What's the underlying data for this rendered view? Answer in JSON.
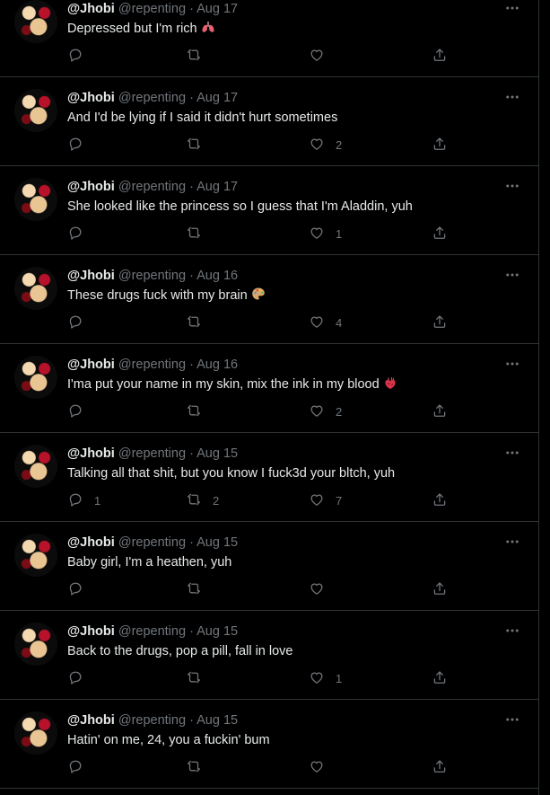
{
  "tweets": [
    {
      "name": "@Jhobi",
      "handle": "@repenting",
      "sep": "·",
      "date": "Aug 17",
      "text": "Depressed but I'm rich",
      "emoji": "lungs-emoji",
      "replies": "",
      "retweets": "",
      "likes": ""
    },
    {
      "name": "@Jhobi",
      "handle": "@repenting",
      "sep": "·",
      "date": "Aug 17",
      "text": "And I'd be lying if I said it didn't hurt sometimes",
      "emoji": "",
      "replies": "",
      "retweets": "",
      "likes": "2"
    },
    {
      "name": "@Jhobi",
      "handle": "@repenting",
      "sep": "·",
      "date": "Aug 17",
      "text": "She looked like the princess so I guess that I'm Aladdin, yuh",
      "emoji": "",
      "replies": "",
      "retweets": "",
      "likes": "1"
    },
    {
      "name": "@Jhobi",
      "handle": "@repenting",
      "sep": "·",
      "date": "Aug 16",
      "text": "These drugs fuck with my brain",
      "emoji": "palette-emoji",
      "replies": "",
      "retweets": "",
      "likes": "4"
    },
    {
      "name": "@Jhobi",
      "handle": "@repenting",
      "sep": "·",
      "date": "Aug 16",
      "text": "I'ma put your name in my skin, mix the ink in my blood",
      "emoji": "anatomical-heart-emoji",
      "replies": "",
      "retweets": "",
      "likes": "2"
    },
    {
      "name": "@Jhobi",
      "handle": "@repenting",
      "sep": "·",
      "date": "Aug 15",
      "text": "Talking all that shit, but you know I fuck3d your bltch, yuh",
      "emoji": "",
      "replies": "1",
      "retweets": "2",
      "likes": "7"
    },
    {
      "name": "@Jhobi",
      "handle": "@repenting",
      "sep": "·",
      "date": "Aug 15",
      "text": "Baby girl, I'm a heathen, yuh",
      "emoji": "",
      "replies": "",
      "retweets": "",
      "likes": ""
    },
    {
      "name": "@Jhobi",
      "handle": "@repenting",
      "sep": "·",
      "date": "Aug 15",
      "text": "Back to the drugs, pop a pill, fall in love",
      "emoji": "",
      "replies": "",
      "retweets": "",
      "likes": "1"
    },
    {
      "name": "@Jhobi",
      "handle": "@repenting",
      "sep": "·",
      "date": "Aug 15",
      "text": "Hatin' on me, 24, you a fuckin' bum",
      "emoji": "",
      "replies": "",
      "retweets": "",
      "likes": ""
    }
  ],
  "colors": {
    "background": "#000000",
    "text": "#e7e9ea",
    "muted": "#71767b",
    "border": "#2f3336"
  }
}
